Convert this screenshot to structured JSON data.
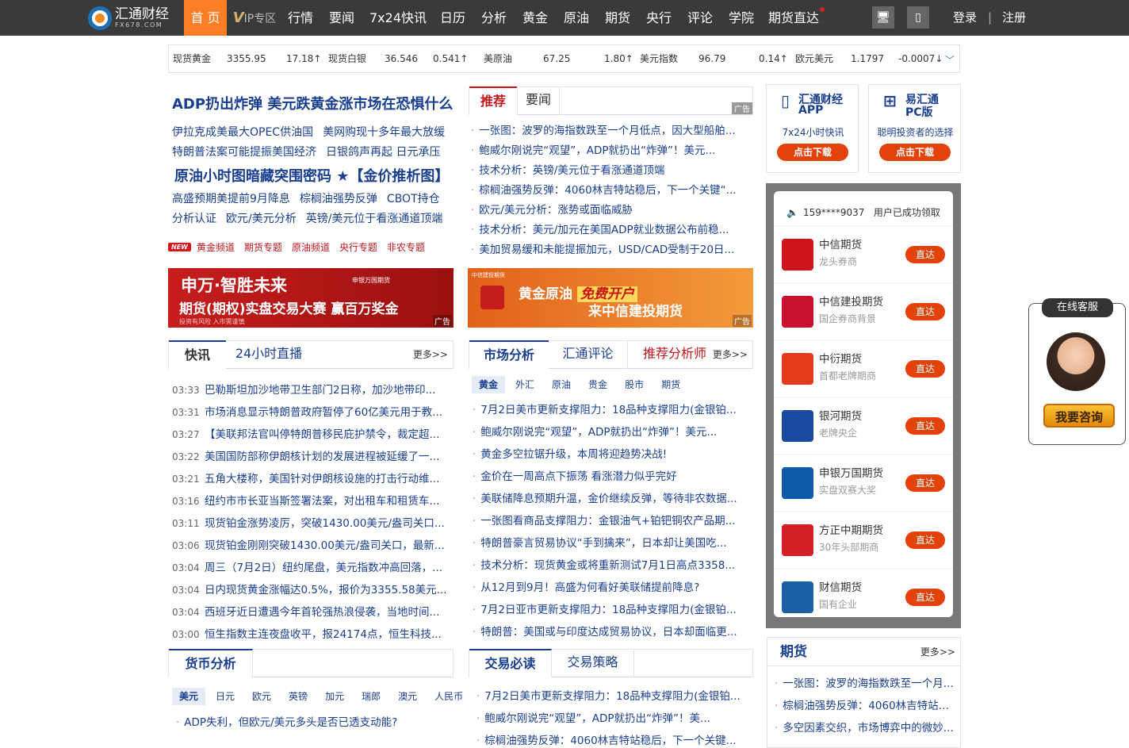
{
  "header": {
    "logo_text": "汇通财经",
    "logo_sub": "FX678.COM",
    "nav": [
      "首 页",
      "IP专区",
      "行情",
      "要闻",
      "7x24快讯",
      "日历",
      "分析",
      "黄金",
      "原油",
      "期货",
      "央行",
      "评论",
      "学院",
      "期货直达"
    ],
    "vip_letter": "V",
    "login": "登录",
    "register": "注册",
    "sep": "|"
  },
  "ticker": [
    {
      "name": "现货黄金",
      "value": "3355.95",
      "change": "17.18",
      "dir": "up"
    },
    {
      "name": "现货白银",
      "value": "36.546",
      "change": "0.541",
      "dir": "up"
    },
    {
      "name": "美原油",
      "value": "67.25",
      "change": "1.80",
      "dir": "up"
    },
    {
      "name": "美元指数",
      "value": "96.79",
      "change": "0.14",
      "dir": "up"
    },
    {
      "name": "欧元美元",
      "value": "1.1797",
      "change": "-0.0007",
      "dir": "down"
    }
  ],
  "headline": "ADP扔出炸弹 美元跌黄金涨市场在恐惧什么",
  "headline_rows": [
    [
      "伊拉克成美最大OPEC供油国",
      "美网购现十多年最大放缓"
    ],
    [
      "特朗普法案可能提振美国经济",
      "日银鸽声再起 日元承压"
    ]
  ],
  "headline2": "原油小时图暗藏突围密码 ★【金价推析图】",
  "headline2_rows": [
    [
      "高盛预期美提前9月降息",
      "棕榈油强势反弹",
      "CBOT持仓"
    ],
    [
      "分析认证",
      "欧元/美元分析",
      "英镑/美元位于看涨通道顶端"
    ]
  ],
  "new_tag": "NEW",
  "channels": [
    "黄金频道",
    "期货专题",
    "原油频道",
    "央行专题",
    "非农专题"
  ],
  "banner1": {
    "line1": "申万·智胜未来",
    "line2": "期货(期权)实盘交易大赛  赢百万奖金",
    "line3": "投资有风险 入市需谨慎",
    "brand": "申银万国期货",
    "ad": "广告"
  },
  "banner2": {
    "top": "中信建投期货",
    "line1a": "黄金原油",
    "line1b": "免费开户",
    "line2": "来中信建投期货",
    "ad": "广告"
  },
  "rec_tabs": [
    "推荐",
    "要闻"
  ],
  "rec_ad": "广告",
  "rec_list": [
    "一张图：波罗的海指数跌至一个月低点，因大型船舶...",
    "鲍威尔刚说完“观望”，ADP就扔出“炸弹”！美元...",
    "技术分析：英镑/美元位于看涨通道顶端",
    "棕榈油强势反弹：4060林吉特站稳后，下一个关键“...",
    "欧元/美元分析：涨势或面临威胁",
    "技术分析：美元/加元在美国ADP就业数据公布前稳...",
    "美加贸易缓和未能提振加元，USD/CAD受制于20日..."
  ],
  "flash_tabs": [
    "快讯",
    "24小时直播"
  ],
  "more": "更多>>",
  "flash": [
    [
      "03:33",
      "巴勒斯坦加沙地带卫生部门2日称，加沙地带印..."
    ],
    [
      "03:31",
      "市场消息显示特朗普政府暂停了60亿美元用于教..."
    ],
    [
      "03:27",
      "【美联邦法官叫停特朗普移民庇护禁令，裁定超..."
    ],
    [
      "03:22",
      "美国国防部称伊朗核计划的发展进程被延缓了一..."
    ],
    [
      "03:21",
      "五角大楼称，美国针对伊朗核设施的打击行动维..."
    ],
    [
      "03:16",
      "纽约市市长亚当斯签署法案，对出租车和租赁车..."
    ],
    [
      "03:11",
      "现货铂金涨势凌厉，突破1430.00美元/盎司关口..."
    ],
    [
      "03:06",
      "现货铂金刚刚突破1430.00美元/盎司关口，最新..."
    ],
    [
      "03:04",
      "周三（7月2日）纽约尾盘，美元指数冲高回落，..."
    ],
    [
      "03:04",
      "日内现货黄金涨幅达0.5%，报价为3355.58美元..."
    ],
    [
      "03:04",
      "西班牙近日遭遇今年首轮强热浪侵袭，当地时间..."
    ],
    [
      "03:00",
      "恒生指数主连夜盘收平，报24174点，恒生科技..."
    ]
  ],
  "market_tabs": [
    "市场分析",
    "汇通评论",
    "推荐分析师"
  ],
  "market_subtabs": [
    "黄金",
    "外汇",
    "原油",
    "贵金",
    "股市",
    "期货"
  ],
  "market_list": [
    "7月2日美市更新支撑阻力：18品种支撑阻力(金银铂...",
    "鲍威尔刚说完“观望”，ADP就扔出“炸弹”！美元...",
    "黄金多空拉锯升级，本周将迎趋势决战!",
    "金价在一周高点下振荡 看涨潜力似乎完好",
    "美联储降息预期升温，金价继续反弹，等待非农数据...",
    "一张图看商品支撑阻力：金银油气+铂钯铜农产品期...",
    "特朗普豪言贸易协议“手到擒来”，日本却让美国吃...",
    "技术分析：现货黄金或将重新测试7月1日高点3358...",
    "从12月到9月！高盛为何看好美联储提前降息?",
    "7月2日亚市更新支撑阻力：18品种支撑阻力(金银铂...",
    "特朗普：美国或与印度达成贸易协议，日本却面临更..."
  ],
  "currency_tab": "货币分析",
  "currency_subtabs": [
    "美元",
    "日元",
    "欧元",
    "英镑",
    "加元",
    "瑞郎",
    "澳元",
    "人民币"
  ],
  "currency_list": [
    "ADP失利，但欧元/美元多头是否已透支动能?"
  ],
  "trade_tabs": [
    "交易必读",
    "交易策略"
  ],
  "trade_list": [
    "7月2日美市更新支撑阻力：18品种支撑阻力(金银铂...",
    "鲍威尔刚说完“观望”，ADP就扔出“炸弹”！美...",
    "棕榈油强势反弹：4060林吉特站稳后，下一个关键..."
  ],
  "app_promo": {
    "title": "汇通财经",
    "title2": "APP",
    "sub": "7x24小时快讯",
    "btn": "点击下载"
  },
  "pc_promo": {
    "title": "易汇通",
    "title2": "PC版",
    "sub": "聪明投资者的选择",
    "btn": "点击下载"
  },
  "notice": {
    "phone": "159****9037",
    "text": "用户已成功领取"
  },
  "brokers": [
    {
      "name": "中信期货",
      "desc": "龙头券商",
      "btn": "直达",
      "color": "#d0141b"
    },
    {
      "name": "中信建投期货",
      "desc": "国企券商背景",
      "btn": "直达",
      "color": "#c8102e"
    },
    {
      "name": "中衍期货",
      "desc": "首都老牌期商",
      "btn": "直达",
      "color": "#e33b1c"
    },
    {
      "name": "银河期货",
      "desc": "老牌央企",
      "btn": "直达",
      "color": "#1a4aa0"
    },
    {
      "name": "申银万国期货",
      "desc": "实盘双赛大奖",
      "btn": "直达",
      "color": "#0c5aa8"
    },
    {
      "name": "方正中期期货",
      "desc": "30年头部期商",
      "btn": "直达",
      "color": "#d51f26"
    },
    {
      "name": "财信期货",
      "desc": "国有企业",
      "btn": "直达",
      "color": "#1b5fa8"
    }
  ],
  "service": {
    "title": "在线客服",
    "btn": "我要咨询"
  },
  "futures": {
    "title": "期货",
    "more": "更多>>",
    "list": [
      "一张图：波罗的海指数跌至一个月...",
      "棕榈油强势反弹：4060林吉特站稳...",
      "多空因素交织，市场博弈中的微妙..."
    ]
  }
}
